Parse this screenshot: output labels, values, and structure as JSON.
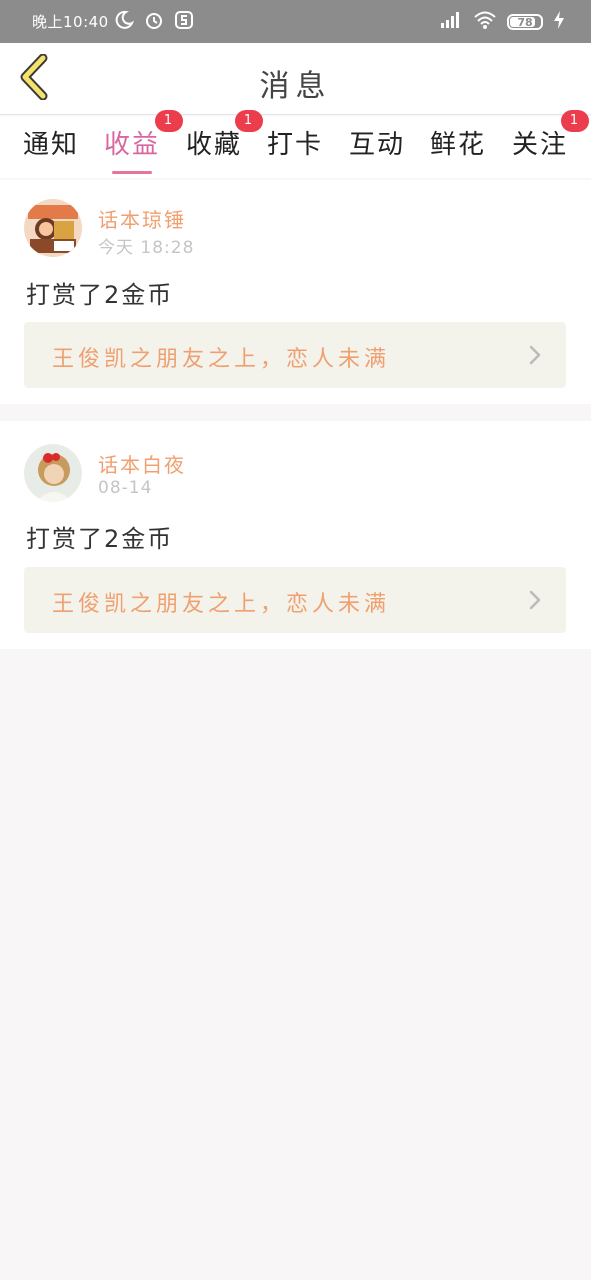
{
  "status_bar": {
    "time": "晚上10:40",
    "battery": "78"
  },
  "header": {
    "title": "消息"
  },
  "tabs": [
    {
      "label": "通知",
      "badge": ""
    },
    {
      "label": "收益",
      "badge": "1",
      "active": true
    },
    {
      "label": "收藏",
      "badge": "1"
    },
    {
      "label": "打卡",
      "badge": ""
    },
    {
      "label": "互动",
      "badge": ""
    },
    {
      "label": "鲜花",
      "badge": ""
    },
    {
      "label": "关注",
      "badge": "1"
    }
  ],
  "messages": [
    {
      "user": "话本琼锤",
      "time": "今天 18:28",
      "action": "打赏了2金币",
      "book": "王俊凯之朋友之上，恋人未满"
    },
    {
      "user": "话本白夜",
      "time": "08-14",
      "action": "打赏了2金币",
      "book": "王俊凯之朋友之上，恋人未满"
    }
  ],
  "colors": {
    "accent": "#d9679f",
    "badge": "#ec3d4d",
    "name": "#f0a070"
  }
}
